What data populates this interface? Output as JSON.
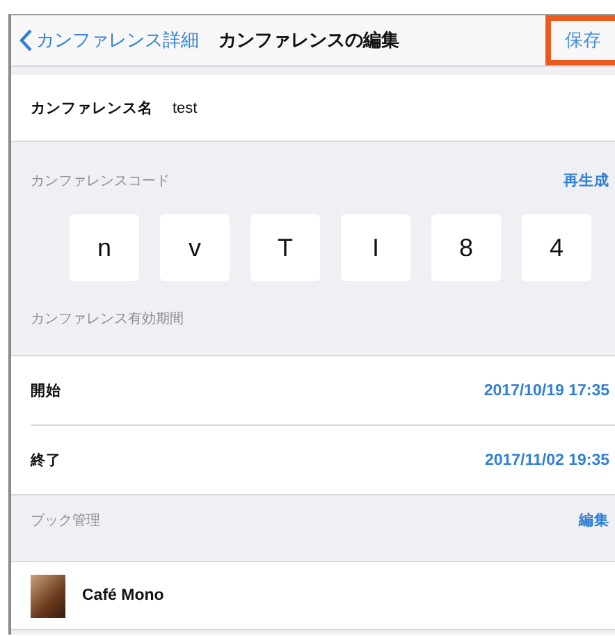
{
  "nav_bar": {
    "back_label": "カンファレンス詳細",
    "title": "カンファレンスの編集",
    "save_button": {
      "label": "保存",
      "highlighted": true
    }
  },
  "name_row": {
    "label": "カンファレンス名",
    "value": "test"
  },
  "code_section": {
    "header": "カンファレンスコード",
    "action": "再生成",
    "characters": [
      "n",
      "v",
      "T",
      "I",
      "8",
      "4"
    ]
  },
  "validity_section": {
    "header": "カンファレンス有効期間",
    "rows": [
      {
        "label": "開始",
        "value": "2017/10/19 17:35"
      },
      {
        "label": "終了",
        "value": "2017/11/02 19:35"
      }
    ]
  },
  "book_section": {
    "header": "ブック管理",
    "action": "編集",
    "books": [
      {
        "title": "Café Mono"
      }
    ]
  }
}
